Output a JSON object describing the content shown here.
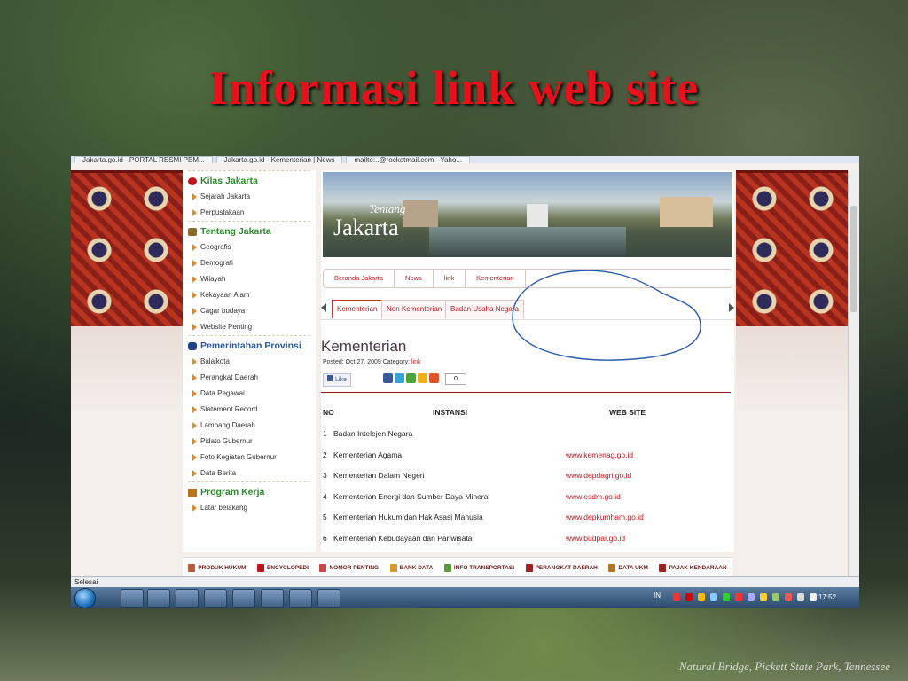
{
  "slide": {
    "title": "Informasi link web site",
    "caption": "Natural Bridge, Pickett State Park, Tennessee"
  },
  "browser": {
    "tabs": [
      "Jakarta.go.id - PORTAL RESMI PEM...",
      "Jakarta.go.id - Kementerian | News",
      "mailto:..@rocketmail.com - Yaho..."
    ],
    "status": "Selesai"
  },
  "sidebar": {
    "sections": [
      {
        "title": "Kilas Jakarta",
        "icon": "mask-icon",
        "items": [
          "Sejarah Jakarta",
          "Perpustakaan"
        ]
      },
      {
        "title": "Tentang Jakarta",
        "icon": "monument-icon",
        "items": [
          "Geografis",
          "Demografi",
          "Wilayah",
          "Kekayaan Alam",
          "Cagar budaya",
          "Website Penting"
        ]
      },
      {
        "title": "Pemerintahan Provinsi",
        "icon": "emblem-icon",
        "items": [
          "Balaikota",
          "Perangkat Daerah",
          "Data Pegawai",
          "Statement Record",
          "Lambang Daerah",
          "Pidato Gubernur",
          "Foto Kegiatan Gubernur",
          "Data Berita"
        ]
      },
      {
        "title": "Program Kerja",
        "icon": "book-icon",
        "items": [
          "Latar belakang"
        ]
      }
    ]
  },
  "hero": {
    "tentang": "Tentang",
    "jakarta": "Jakarta"
  },
  "breadcrumb": [
    "Beranda Jakarta",
    "News",
    "link",
    "Kementerian"
  ],
  "tabs": [
    "Kementerian",
    "Non Kementerian",
    "Badan Usaha Negara"
  ],
  "article": {
    "heading": "Kementerian",
    "posted": "Posted: Oct 27, 2009 Category:",
    "category": "link",
    "like": "Like",
    "share_count": "0"
  },
  "table": {
    "headers": {
      "no": "NO",
      "instansi": "INSTANSI",
      "website": "WEB SITE"
    },
    "rows": [
      {
        "no": "1",
        "name": "Badan Intelejen Negara",
        "url": ""
      },
      {
        "no": "2",
        "name": "Kementerian Agama",
        "url": "www.kemenag.go.id"
      },
      {
        "no": "3",
        "name": "Kementerian Dalam Negeri",
        "url": "www.depdagri.go.id"
      },
      {
        "no": "4",
        "name": "Kementerian Energi dan Sumber Daya Mineral",
        "url": "www.esdm.go.id"
      },
      {
        "no": "5",
        "name": "Kementerian Hukum dan Hak Asasi Manusia",
        "url": "www.depkumham.go.id"
      },
      {
        "no": "6",
        "name": "Kementerian Kebudayaan dan Pariwisata",
        "url": "www.budpar.go.id"
      }
    ]
  },
  "footer_links": [
    "PRODUK HUKUM",
    "ENCYCLOPEDI",
    "NOMOR PENTING",
    "BANK DATA",
    "INFO TRANSPORTASI",
    "PERANGKAT DAERAH",
    "DATA UKM",
    "PAJAK KENDARAAN"
  ],
  "taskbar": {
    "lang": "IN",
    "clock": "17:52"
  },
  "colors": {
    "title": "#e8101a",
    "link": "#c0141a",
    "sidebar_heading": "#2d8a2d",
    "annotation": "#2a5aa8"
  }
}
